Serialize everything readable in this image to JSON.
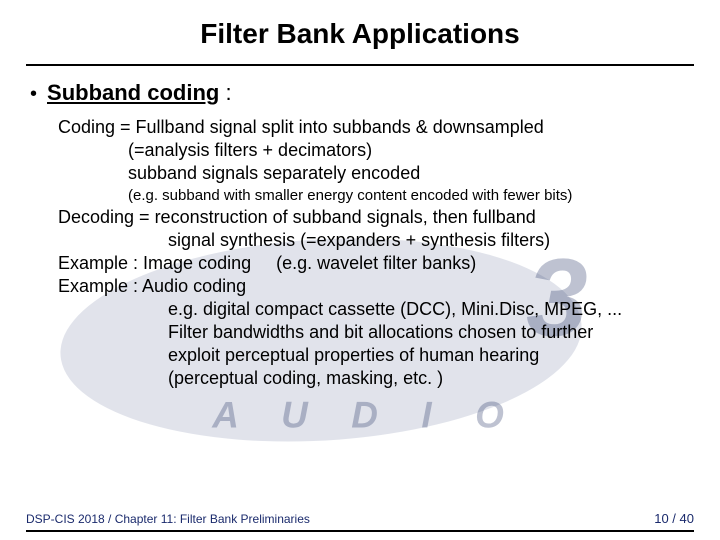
{
  "title": "Filter Bank Applications",
  "bullet": {
    "heading": "Subband coding",
    "colon": " :"
  },
  "coding": {
    "line1": "Coding = Fullband signal split into subbands & downsampled",
    "line2": "(=analysis filters + decimators)",
    "line3": "subband signals separately encoded",
    "note": "(e.g. subband with smaller energy content encoded with fewer bits)"
  },
  "decoding": {
    "line1": "Decoding = reconstruction of subband signals, then fullband",
    "line2": "signal synthesis  (=expanders + synthesis filters)"
  },
  "example1": {
    "label": "Example : Image coding",
    "eg": "(e.g. wavelet filter banks)"
  },
  "example2": {
    "label": "Example : Audio coding",
    "line1": "e.g. digital compact cassette (DCC), Mini.Disc, MPEG, ...",
    "line2": "Filter bandwidths and bit allocations chosen to further",
    "line3": "exploit perceptual properties of human hearing",
    "line4": "(perceptual coding, masking, etc. )"
  },
  "footer": {
    "left": "DSP-CIS 2018  / Chapter 11: Filter Bank Preliminaries",
    "page": "10 / 40"
  },
  "watermark": {
    "text_top": "3",
    "text_bottom": "A   U   D   I   O"
  }
}
